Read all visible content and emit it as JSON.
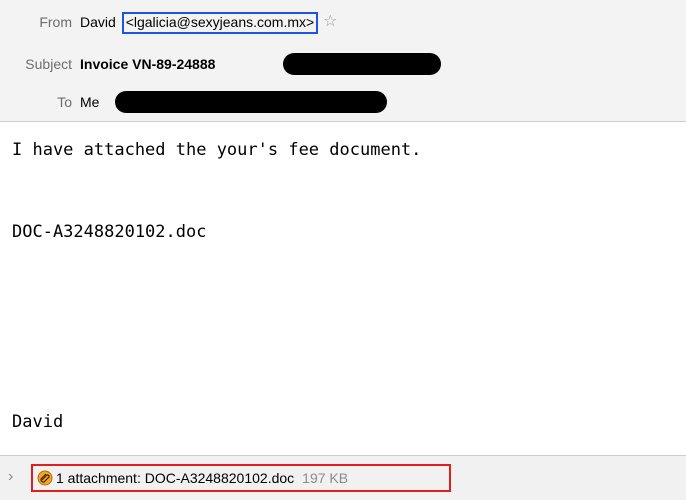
{
  "header": {
    "from_label": "From",
    "from_name": "David",
    "from_email": "<lgalicia@sexyjeans.com.mx>",
    "subject_label": "Subject",
    "subject_value": "Invoice VN-89-24888",
    "to_label": "To",
    "to_value": "Me"
  },
  "icons": {
    "star": "☆",
    "chevron": "›"
  },
  "body": {
    "line1": "I have attached the your's fee document.",
    "line2": "DOC-A3248820102.doc",
    "signature": "David"
  },
  "attachment": {
    "label": "1 attachment: DOC-A3248820102.doc",
    "size": "197 KB"
  },
  "colors": {
    "email_highlight": "#1a56e6",
    "attachment_highlight": "#e21d1d"
  }
}
